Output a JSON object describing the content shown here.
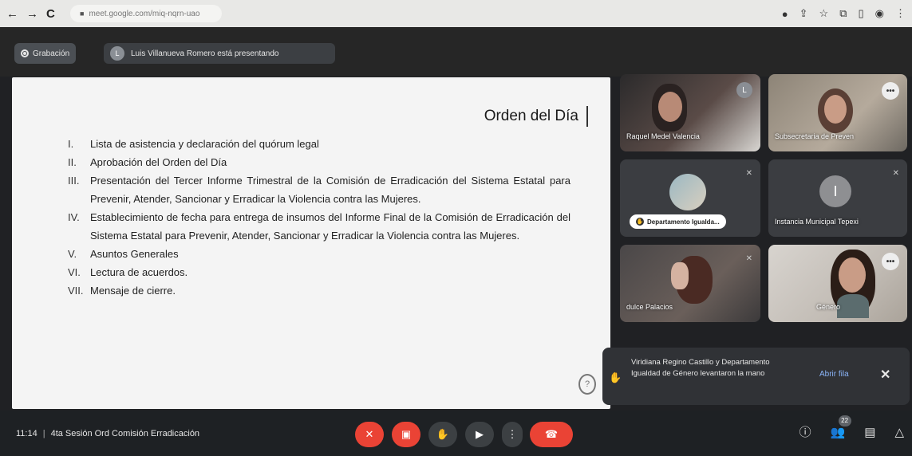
{
  "browser": {
    "url": "meet.google.com/miq-nqrn-uao",
    "nav_back": "←",
    "nav_forward": "→",
    "nav_reload": "C"
  },
  "top": {
    "recording_label": "Grabación",
    "presenter_initial": "L",
    "presenter_text": "Luis Villanueva Romero está presentando"
  },
  "slide": {
    "title": "Orden del Día",
    "items": [
      {
        "num": "I.",
        "text": "Lista de asistencia y declaración del quórum legal"
      },
      {
        "num": "II.",
        "text": "Aprobación del Orden del Día"
      },
      {
        "num": "III.",
        "text": "Presentación del Tercer Informe Trimestral de la Comisión de Erradicación del Sistema Estatal para Prevenir, Atender, Sancionar y Erradicar la Violencia contra las Mujeres."
      },
      {
        "num": "IV.",
        "text": "Establecimiento de fecha para entrega de insumos del Informe Final de la Comisión de Erradicación del Sistema Estatal para Prevenir, Atender, Sancionar y Erradicar la Violencia contra las Mujeres."
      },
      {
        "num": "V.",
        "text": "Asuntos Generales"
      },
      {
        "num": "VI.",
        "text": "Lectura de acuerdos."
      },
      {
        "num": "VII.",
        "text": "Mensaje de cierre."
      }
    ]
  },
  "participants": [
    {
      "name": "Raquel Medel Valencia",
      "badge": "L"
    },
    {
      "name": "Subsecretaria de Preven"
    },
    {
      "name": "Departamento Igualda..."
    },
    {
      "name": "Instancia Municipal Tepexi",
      "initial": "I"
    },
    {
      "name": "dulce Palacios"
    },
    {
      "name": "Género"
    }
  ],
  "notification": {
    "message": "Viridiana Regino Castillo y Departamento Igualdad de Género levantaron la mano",
    "action": "Abrir fila",
    "close": "✕"
  },
  "bottom": {
    "time": "11:14",
    "separator": "|",
    "meeting_name": "4ta Sesión Ord Comisión Erradicación",
    "people_count": "22"
  },
  "colors": {
    "leave_red": "#ea4335",
    "control_gray": "#3c4043",
    "link_blue": "#8ab4f8"
  }
}
